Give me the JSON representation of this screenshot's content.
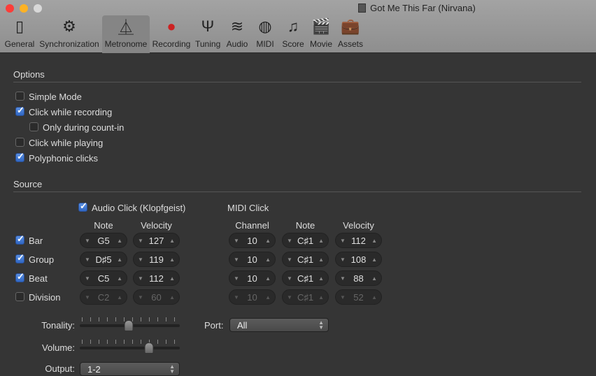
{
  "window": {
    "title": "Got Me This Far (Nirvana)"
  },
  "toolbar": [
    {
      "label": "General",
      "icon": "general-switch-icon",
      "glyph": "▯"
    },
    {
      "label": "Synchronization",
      "icon": "gears-icon",
      "glyph": "⚙"
    },
    {
      "label": "Metronome",
      "icon": "metronome-icon",
      "glyph": "⏅"
    },
    {
      "label": "Recording",
      "icon": "record-icon",
      "glyph": "●"
    },
    {
      "label": "Tuning",
      "icon": "tuning-fork-icon",
      "glyph": "Ψ"
    },
    {
      "label": "Audio",
      "icon": "waveform-icon",
      "glyph": "≋"
    },
    {
      "label": "MIDI",
      "icon": "midi-port-icon",
      "glyph": "◍"
    },
    {
      "label": "Score",
      "icon": "score-notes-icon",
      "glyph": "♫"
    },
    {
      "label": "Movie",
      "icon": "clapperboard-icon",
      "glyph": "🎬"
    },
    {
      "label": "Assets",
      "icon": "briefcase-icon",
      "glyph": "💼"
    }
  ],
  "options": {
    "heading": "Options",
    "items": [
      {
        "label": "Simple Mode",
        "checked": false
      },
      {
        "label": "Click while recording",
        "checked": true
      },
      {
        "label": "Only during count-in",
        "checked": false
      },
      {
        "label": "Click while playing",
        "checked": false
      },
      {
        "label": "Polyphonic clicks",
        "checked": true
      }
    ]
  },
  "source": {
    "heading": "Source",
    "audio_click": {
      "label": "Audio Click (Klopfgeist)",
      "checked": true
    },
    "midi_click": {
      "label": "MIDI Click"
    },
    "headers": {
      "note": "Note",
      "velocity": "Velocity",
      "channel": "Channel",
      "midi_note": "Note",
      "midi_velocity": "Velocity"
    },
    "rows": [
      {
        "label": "Bar",
        "checked": true,
        "note": "G5",
        "velocity": "127",
        "channel": "10",
        "midi_note": "C♯1",
        "midi_velocity": "112"
      },
      {
        "label": "Group",
        "checked": true,
        "note": "D♯5",
        "velocity": "119",
        "channel": "10",
        "midi_note": "C♯1",
        "midi_velocity": "108"
      },
      {
        "label": "Beat",
        "checked": true,
        "note": "C5",
        "velocity": "112",
        "channel": "10",
        "midi_note": "C♯1",
        "midi_velocity": "88"
      },
      {
        "label": "Division",
        "checked": false,
        "note": "C2",
        "velocity": "60",
        "channel": "10",
        "midi_note": "C♯1",
        "midi_velocity": "52"
      }
    ],
    "tonality": {
      "label": "Tonality:",
      "value_percent": 49
    },
    "volume": {
      "label": "Volume:",
      "value_percent": 69
    },
    "port": {
      "label": "Port:",
      "value": "All"
    },
    "output": {
      "label": "Output:",
      "value": "1-2"
    }
  }
}
